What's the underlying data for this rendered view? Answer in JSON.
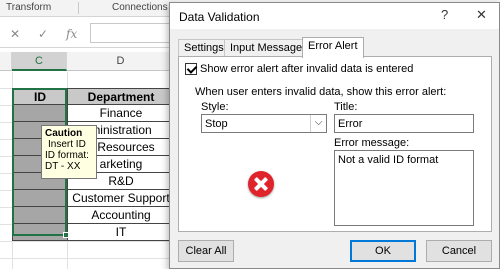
{
  "ribbon": {
    "groups": [
      "Transform",
      "Connections"
    ]
  },
  "formula_bar": {
    "cancel": "✕",
    "enter": "✓",
    "fx": "fx"
  },
  "columns": {
    "c": "C",
    "d": "D"
  },
  "table": {
    "headers": {
      "id": "ID",
      "department": "Department"
    },
    "departments": [
      "Finance",
      "Administration",
      "Human Resources",
      "Marketing",
      "R&D",
      "Customer Support",
      "Accounting",
      "IT"
    ],
    "visible_departments": [
      "Finance",
      "ministration",
      "n Resources",
      "arketing",
      "R&D",
      "Customer Support",
      "Accounting",
      "IT"
    ]
  },
  "tooltip": {
    "title": "Caution",
    "lines": [
      "Insert ID",
      "ID format:",
      "DT - XX"
    ]
  },
  "dialog": {
    "title": "Data Validation",
    "help": "?",
    "close": "✕",
    "tabs": [
      "Settings",
      "Input Message",
      "Error Alert"
    ],
    "active_tab": "Error Alert",
    "show_alert_checkbox": {
      "label": "Show error alert after invalid data is entered",
      "checked": true
    },
    "instruction": "When user enters invalid data, show this error alert:",
    "style_label": "Style:",
    "style_value": "Stop",
    "title_label": "Title:",
    "title_value": "Error",
    "message_label": "Error message:",
    "message_value": "Not a valid ID format",
    "buttons": {
      "clear_all": "Clear All",
      "ok": "OK",
      "cancel": "Cancel"
    },
    "accent_color": "#0078d7",
    "error_icon_color": "#e0242b"
  },
  "selection_color": "#217346"
}
